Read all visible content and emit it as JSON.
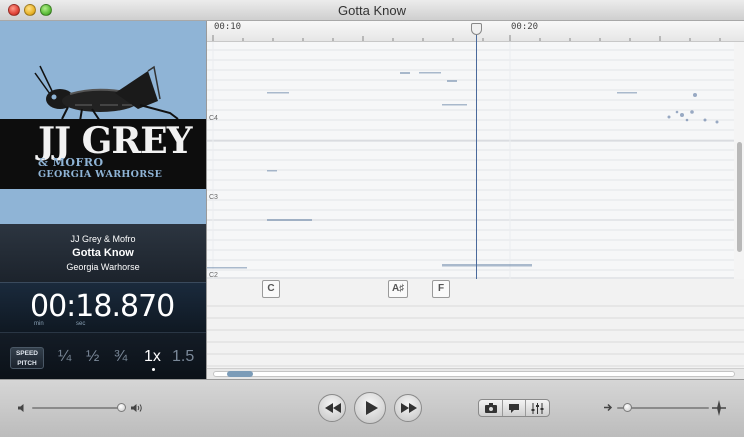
{
  "window": {
    "title": "Gotta Know"
  },
  "album": {
    "logo_main": "JJ GREY",
    "logo_sub": "& MOFRO",
    "logo_sub2": "GEORGIA WARHORSE"
  },
  "track": {
    "artist": "JJ Grey & Mofro",
    "title": "Gotta Know",
    "album": "Georgia Warhorse"
  },
  "time": {
    "display": "00:18.870",
    "min_label": "min",
    "sec_label": "sec"
  },
  "speed": {
    "button_top": "SPEED",
    "button_bottom": "PITCH",
    "options": [
      "¼",
      "½",
      "¾",
      "1x",
      "1.5"
    ],
    "selected": "1x"
  },
  "ruler": {
    "marks": [
      "00:10",
      "00:20"
    ]
  },
  "pitch_labels": [
    "C4",
    "C3",
    "C2"
  ],
  "chords": [
    "C",
    "A♯",
    "F"
  ],
  "colors": {
    "accent": "#4a6a9c",
    "album_bg": "#8fb4d6"
  },
  "controls": {
    "icons": [
      "volume-low-icon",
      "volume-high-icon",
      "rewind-icon",
      "play-icon",
      "fast-forward-icon",
      "camera-icon",
      "speech-bubble-icon",
      "mixer-icon",
      "zoom-out-icon",
      "zoom-in-icon"
    ]
  }
}
